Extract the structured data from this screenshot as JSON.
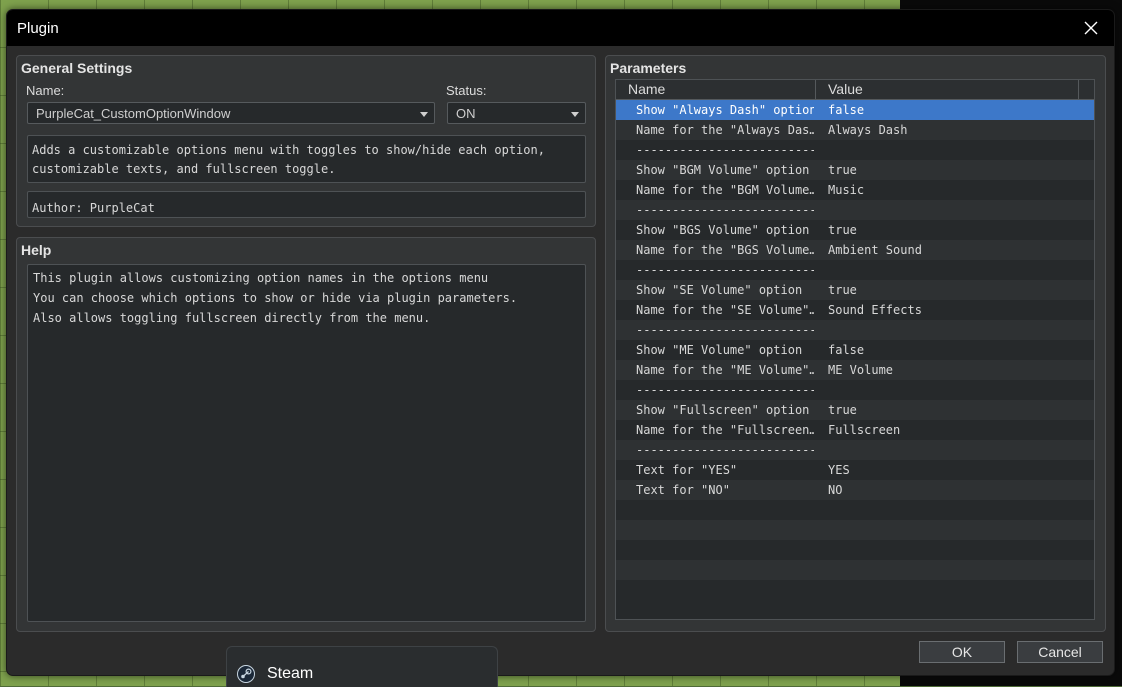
{
  "window": {
    "title": "Plugin"
  },
  "general": {
    "heading": "General Settings",
    "name_label": "Name:",
    "name_value": "PurpleCat_CustomOptionWindow",
    "status_label": "Status:",
    "status_value": "ON",
    "description_lines": [
      "Adds a customizable options menu with toggles to show/hide each option,",
      "customizable texts, and fullscreen toggle."
    ],
    "author": "Author: PurpleCat"
  },
  "help": {
    "heading": "Help",
    "lines": [
      "This plugin allows customizing option names in the options menu",
      "You can choose which options to show or hide via plugin parameters.",
      "Also allows toggling fullscreen directly from the menu."
    ]
  },
  "parameters": {
    "heading": "Parameters",
    "columns": [
      "Name",
      "Value"
    ],
    "rows": [
      {
        "name": "Show \"Always Dash\" option",
        "value": "false"
      },
      {
        "name": "Name for the \"Always Das…",
        "value": "Always Dash"
      },
      {
        "name": "-------------------------",
        "value": ""
      },
      {
        "name": "Show \"BGM Volume\" option",
        "value": "true"
      },
      {
        "name": "Name for the \"BGM Volume…",
        "value": "Music"
      },
      {
        "name": "-------------------------",
        "value": ""
      },
      {
        "name": "Show \"BGS Volume\" option",
        "value": "true"
      },
      {
        "name": "Name for the \"BGS Volume…",
        "value": "Ambient Sound"
      },
      {
        "name": "-------------------------",
        "value": ""
      },
      {
        "name": "Show \"SE Volume\" option",
        "value": "true"
      },
      {
        "name": "Name for the \"SE Volume\"…",
        "value": "Sound Effects"
      },
      {
        "name": "-------------------------",
        "value": ""
      },
      {
        "name": "Show \"ME Volume\" option",
        "value": "false"
      },
      {
        "name": "Name for the \"ME Volume\"…",
        "value": "ME Volume"
      },
      {
        "name": "-------------------------",
        "value": ""
      },
      {
        "name": "Show \"Fullscreen\" option",
        "value": "true"
      },
      {
        "name": "Name for the \"Fullscreen…",
        "value": "Fullscreen"
      },
      {
        "name": "-------------------------",
        "value": ""
      },
      {
        "name": "Text for \"YES\"",
        "value": "YES"
      },
      {
        "name": "Text for \"NO\"",
        "value": "NO"
      },
      {
        "name": "",
        "value": ""
      },
      {
        "name": "",
        "value": ""
      },
      {
        "name": "",
        "value": ""
      },
      {
        "name": "",
        "value": ""
      },
      {
        "name": "",
        "value": ""
      }
    ],
    "selected_index": 0
  },
  "buttons": {
    "ok": "OK",
    "cancel": "Cancel"
  },
  "taskbar": {
    "label": "Steam"
  },
  "colors": {
    "selection": "#3d78c9",
    "dialog_bg": "#2b2b2b"
  }
}
